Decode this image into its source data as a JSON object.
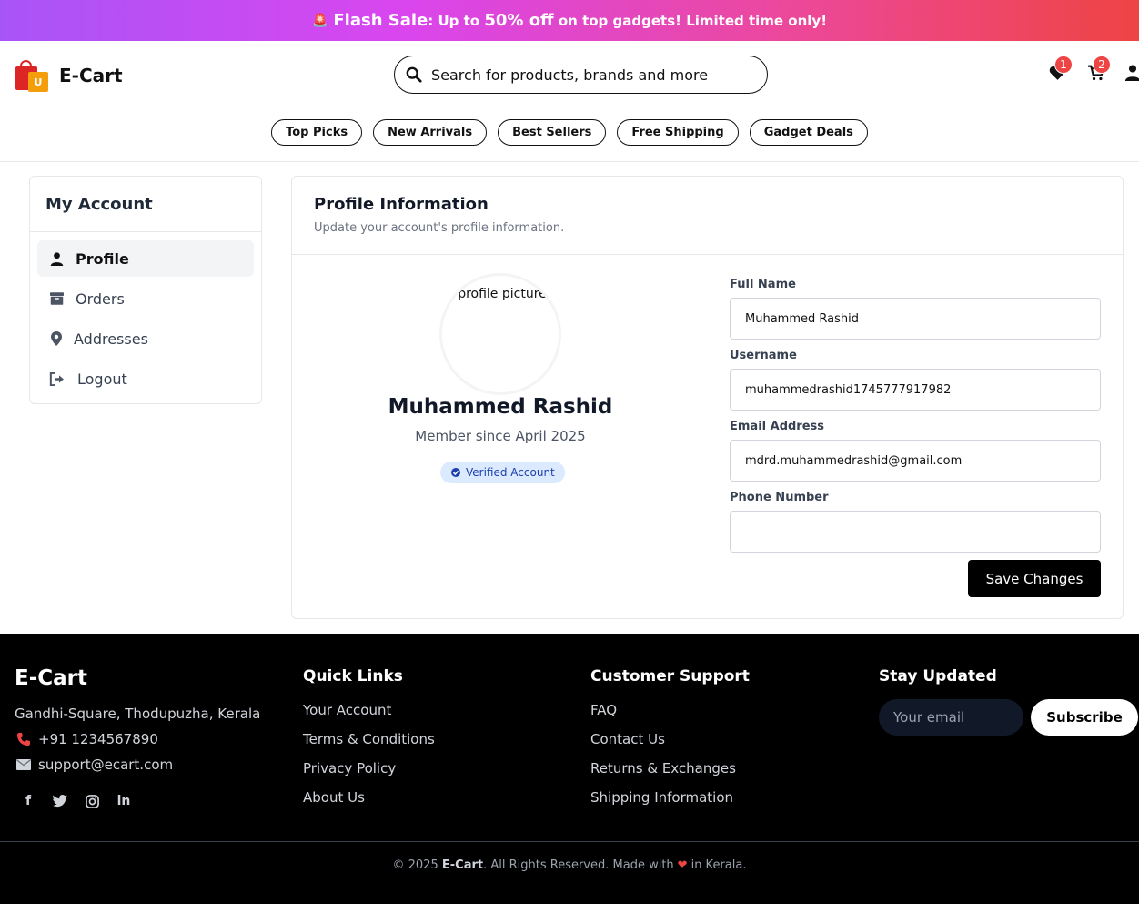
{
  "flash": {
    "label": "Flash Sale",
    "text1": ": Up to ",
    "highlight": "50% off",
    "text2": " on top gadgets! Limited time only!"
  },
  "header": {
    "brand": "E-Cart",
    "logo_letter": "U",
    "search_placeholder": "Search for products, brands and more",
    "wishlist_count": "1",
    "cart_count": "2"
  },
  "categories": [
    "Top Picks",
    "New Arrivals",
    "Best Sellers",
    "Free Shipping",
    "Gadget Deals"
  ],
  "sidebar": {
    "title": "My Account",
    "items": [
      {
        "label": "Profile",
        "icon": "user-icon"
      },
      {
        "label": "Orders",
        "icon": "box-icon"
      },
      {
        "label": "Addresses",
        "icon": "map-pin-icon"
      },
      {
        "label": "Logout",
        "icon": "logout-icon"
      }
    ]
  },
  "profile": {
    "title": "Profile Information",
    "subtitle": "Update your account's profile information.",
    "avatar_alt": "profile picture",
    "name": "Muhammed Rashid",
    "member_since": "Member since April 2025",
    "verified": "Verified Account",
    "fields": {
      "full_name_label": "Full Name",
      "full_name_value": "Muhammed Rashid",
      "username_label": "Username",
      "username_value": "muhammedrashid1745777917982",
      "email_label": "Email Address",
      "email_value": "mdrd.muhammedrashid@gmail.com",
      "phone_label": "Phone Number",
      "phone_value": ""
    },
    "save_label": "Save Changes"
  },
  "footer": {
    "brand": "E-Cart",
    "address": "Gandhi-Square, Thodupuzha, Kerala",
    "phone": "+91 1234567890",
    "email": "support@ecart.com",
    "quick_links_title": "Quick Links",
    "quick_links": [
      "Your Account",
      "Terms & Conditions",
      "Privacy Policy",
      "About Us"
    ],
    "support_title": "Customer Support",
    "support_links": [
      "FAQ",
      "Contact Us",
      "Returns & Exchanges",
      "Shipping Information"
    ],
    "newsletter_title": "Stay Updated",
    "newsletter_placeholder": "Your email",
    "subscribe_label": "Subscribe",
    "copyright_prefix": "© 2025 ",
    "copyright_brand": "E-Cart",
    "copyright_mid": ". All Rights Reserved. Made with",
    "copyright_suffix": "in Kerala."
  }
}
